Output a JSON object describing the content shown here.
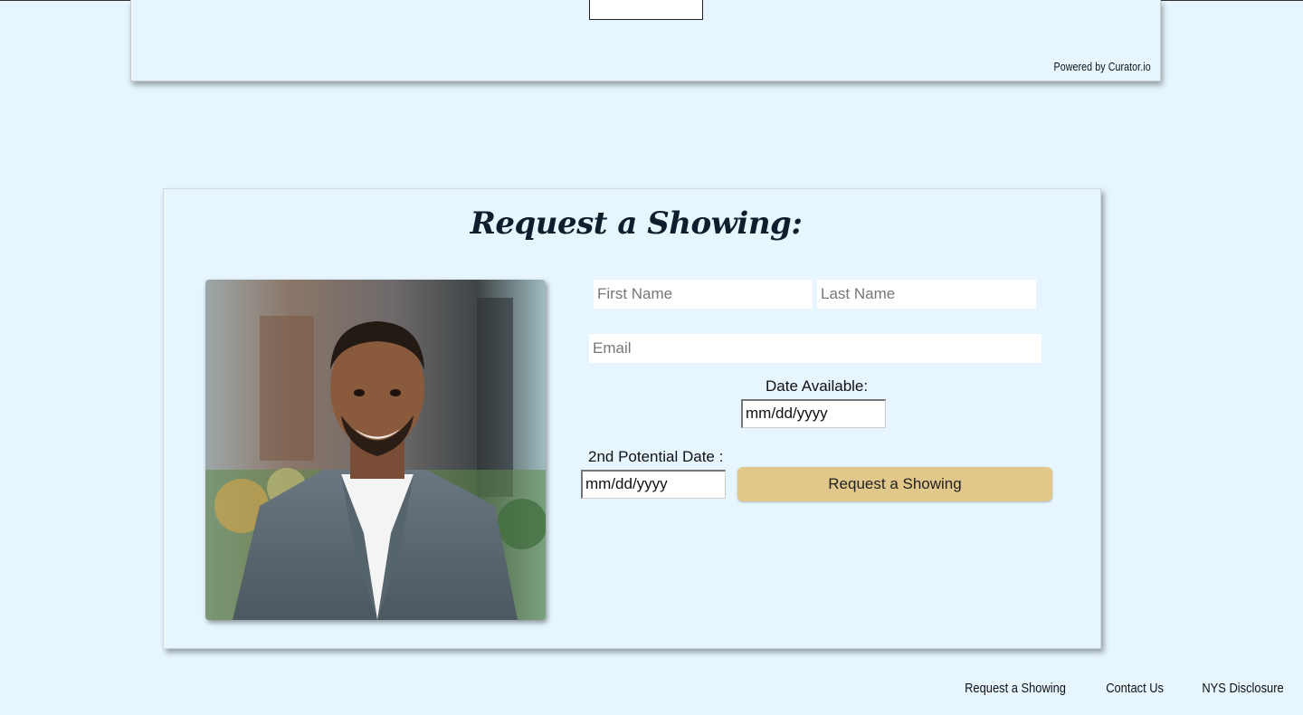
{
  "feed": {
    "powered_by": "Powered by Curator.io"
  },
  "showing_form": {
    "heading": "Request a Showing:",
    "first_name_placeholder": "First Name",
    "last_name_placeholder": "Last Name",
    "email_placeholder": "Email",
    "date_available_label": "Date Available:",
    "date_available_value": "mm/dd/yyyy",
    "second_date_label": "2nd Potential Date :",
    "second_date_value": "mm/dd/yyyy",
    "submit_label": "Request a Showing",
    "button_color": "#e1c78a"
  },
  "footer": {
    "links": [
      "Request a Showing",
      "Contact Us",
      "NYS Disclosure"
    ]
  },
  "colors": {
    "page_background": "#e6f5fe",
    "heading_color": "#0f1d2c"
  }
}
